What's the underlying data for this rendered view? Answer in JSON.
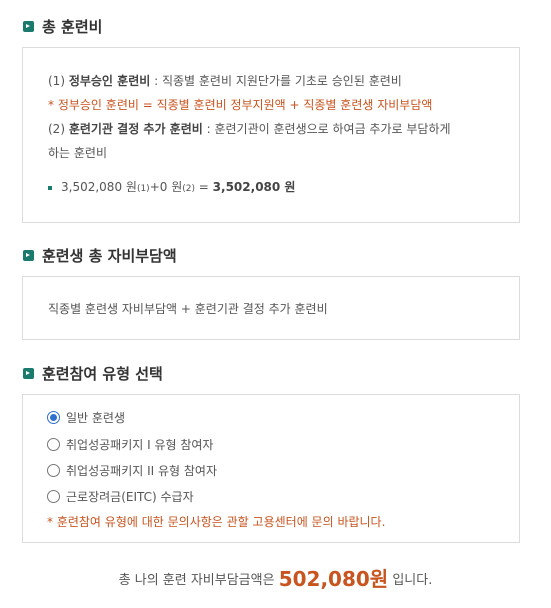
{
  "sections": {
    "total_cost": {
      "title": "총 훈련비",
      "line1_prefix": "(1) ",
      "line1_bold": "정부승인 훈련비",
      "line1_rest": " : 직종별 훈련비 지원단가를 기초로 승인된 훈련비",
      "note": "* 정부승인 훈련비 = 직종별 훈련비 정부지원액 + 직종별 훈련생 자비부담액",
      "line2_prefix": "(2) ",
      "line2_bold": "훈련기관 결정 추가 훈련비",
      "line2_rest": " : 훈련기관이 훈련생으로 하여금 추가로 부담하게",
      "line3": "하는 훈련비",
      "calc_part1": "3,502,080 원",
      "calc_sub1": "(1)",
      "calc_part2": "+0 원",
      "calc_sub2": "(2)",
      "calc_equals": " = ",
      "calc_result": "3,502,080 원"
    },
    "self_pay": {
      "title": "훈련생 총 자비부담액",
      "formula": "직종별 훈련생 자비부담액 + 훈련기관 결정 추가 훈련비"
    },
    "participation": {
      "title": "훈련참여 유형 선택",
      "options": [
        {
          "label": "일반 훈련생",
          "checked": true
        },
        {
          "label": "취업성공패키지 I 유형 참여자",
          "checked": false
        },
        {
          "label": "취업성공패키지 II 유형 참여자",
          "checked": false
        },
        {
          "label": "근로장려금(EITC) 수급자",
          "checked": false
        }
      ],
      "note": "* 훈련참여 유형에 대한 문의사항은 관할 고용센터에 문의 바랍니다."
    }
  },
  "footer": {
    "prefix": "총 나의 훈련 자비부담금액은 ",
    "amount": "502,080원",
    "suffix": " 입니다."
  },
  "colors": {
    "accent": "#c8541f",
    "icon": "#1a7a6e",
    "border": "#dcdcdc",
    "radio_checked": "#2f6fd0"
  }
}
